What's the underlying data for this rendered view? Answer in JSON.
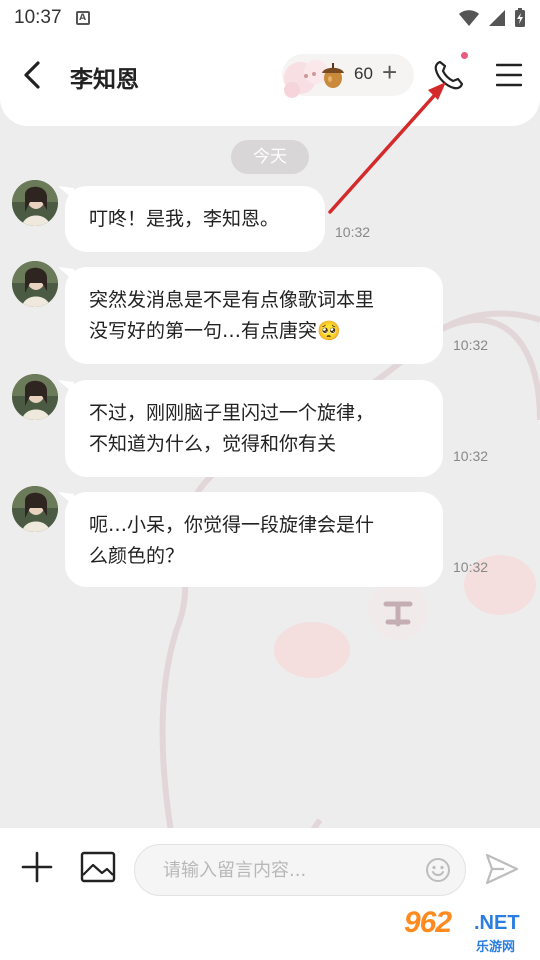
{
  "status_bar": {
    "time": "10:37",
    "app_icon": "A",
    "icons": [
      "wifi-icon",
      "signal-icon",
      "battery-charging-icon"
    ]
  },
  "header": {
    "title": "李知恩",
    "coin_count": "60",
    "coin_plus": "+",
    "icons": [
      "back-icon",
      "acorn-icon",
      "phone-icon",
      "menu-icon"
    ]
  },
  "date_divider": "今天",
  "messages": [
    {
      "lines": [
        "叮咚！是我，李知恩。"
      ],
      "time": "10:32"
    },
    {
      "lines": [
        "突然发消息是不是有点像歌词本里",
        "没写好的第一句…有点唐突🥺"
      ],
      "time": "10:32"
    },
    {
      "lines": [
        "不过，刚刚脑子里闪过一个旋律，",
        "不知道为什么，觉得和你有关"
      ],
      "time": "10:32"
    },
    {
      "lines": [
        "呃…小呆，你觉得一段旋律会是什",
        "么颜色的？"
      ],
      "time": "10:32"
    }
  ],
  "input": {
    "placeholder": "请输入留言内容...",
    "value": "",
    "icons": [
      "add-icon",
      "image-icon",
      "emoji-icon",
      "send-icon"
    ]
  },
  "watermark": {
    "main": "962",
    "suffix": ".NET",
    "sub": "乐游网"
  },
  "colors": {
    "background": "#eeedee",
    "bubble": "#ffffff",
    "notification_dot": "#e85a7e",
    "annotation_arrow": "#d42a2a",
    "date_chip": "#d8d6d7"
  }
}
